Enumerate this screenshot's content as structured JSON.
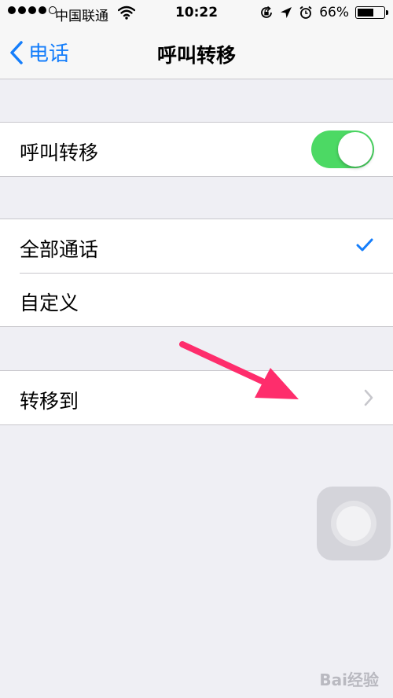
{
  "status_bar": {
    "carrier": "中国联通",
    "time": "10:22",
    "battery": "66%",
    "battery_level": 0.66
  },
  "nav": {
    "back_label": "电话",
    "title": "呼叫转移"
  },
  "groups": {
    "forwarding": {
      "label": "呼叫转移",
      "enabled": true
    },
    "scope": {
      "all_calls": "全部通话",
      "custom": "自定义",
      "selected": "all_calls"
    },
    "forward_to": {
      "label": "转移到"
    }
  },
  "watermark": "Bai经验",
  "colors": {
    "accent": "#157efb",
    "toggle_on": "#4cd964",
    "annotation_arrow": "#fe2d6c"
  }
}
